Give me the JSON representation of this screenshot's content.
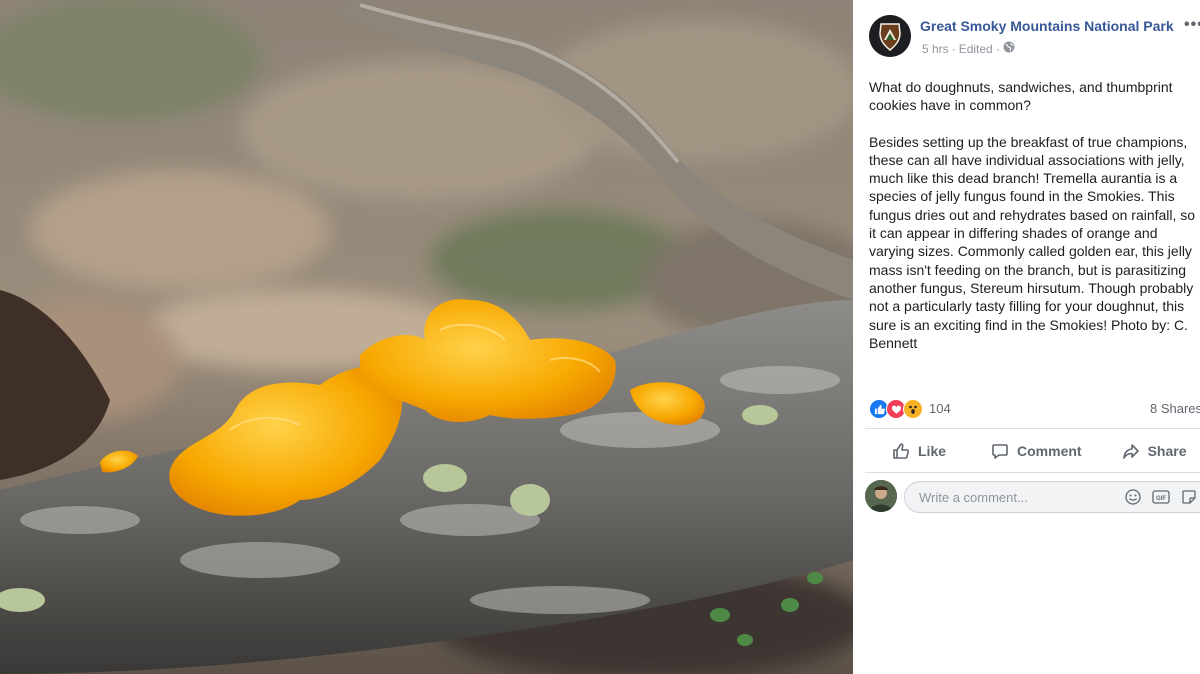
{
  "post": {
    "page_name": "Great Smoky Mountains National Park",
    "time": "5 hrs",
    "separator": "·",
    "edited": "Edited",
    "separator2": "·",
    "more": "•••",
    "paragraphs": [
      "What do doughnuts, sandwiches, and thumbprint cookies have in common?",
      "Besides setting up the breakfast of true champions, these can all have individual associations with jelly, much like this dead branch! Tremella aurantia is a species of jelly fungus found in the Smokies. This fungus dries out and rehydrates based on rainfall, so it can appear in differing shades of orange and varying sizes. Commonly called golden ear, this jelly mass isn't feeding on the branch, but is parasitizing another fungus, Stereum hirsutum. Though probably not a particularly tasty filling for your doughnut, this sure is an exciting find in the Smokies! Photo by: C. Bennett"
    ]
  },
  "reactions": {
    "count": "104",
    "shares": "8 Shares",
    "icons": [
      "like-icon",
      "love-icon",
      "wow-icon"
    ]
  },
  "actions": {
    "like": "Like",
    "comment": "Comment",
    "share": "Share"
  },
  "comment_box": {
    "placeholder": "Write a comment..."
  },
  "colors": {
    "link": "#385898",
    "like_blue": "#1877f2",
    "love_red": "#f33e58",
    "wow_yellow": "#f7b125",
    "fungus_orange": "#f7a800"
  }
}
